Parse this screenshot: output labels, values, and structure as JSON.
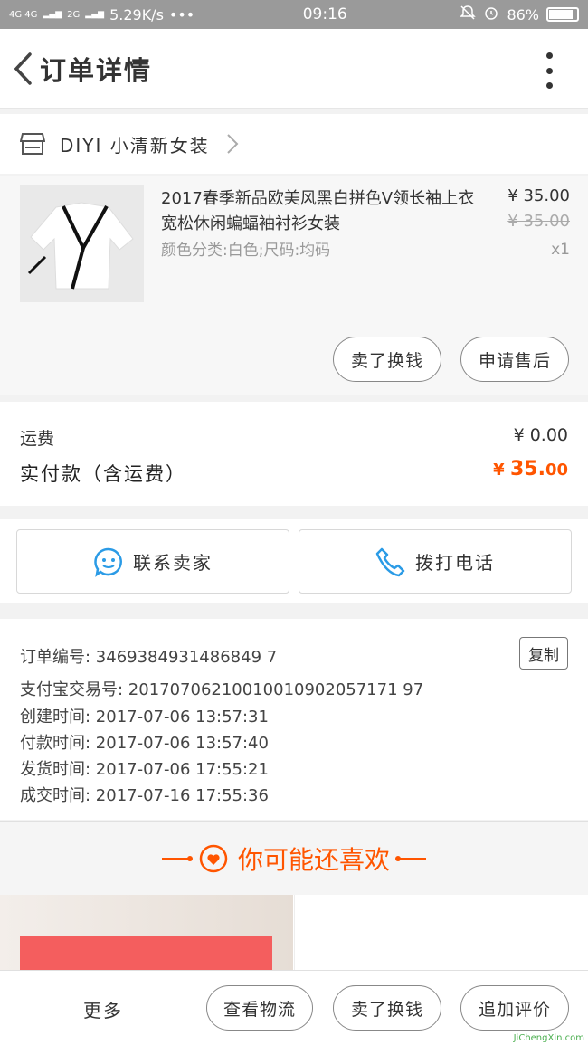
{
  "status_bar": {
    "network": "4G 4G",
    "network2": "2G",
    "speed": "5.29K/s",
    "dots": "•••",
    "time": "09:16",
    "battery": "86%",
    "battery_level": 0.86
  },
  "nav": {
    "title": "订单详情"
  },
  "shop": {
    "name": "DIYI 小清新女装"
  },
  "product": {
    "title": "2017春季新品欧美风黑白拼色V领长袖上衣宽松休闲蝙蝠袖衬衫女装",
    "attributes": "颜色分类:白色;尺码:均码",
    "price": "¥ 35.00",
    "original_price": "¥ 35.00",
    "quantity": "x1",
    "buttons": {
      "sell_swap": "卖了换钱",
      "after_sale": "申请售后"
    }
  },
  "fees": {
    "shipping_label": "运费",
    "shipping_value": "¥ 0.00",
    "paid_label": "实付款（含运费）",
    "paid_currency": "¥ ",
    "paid_int": "35.",
    "paid_dec": "00"
  },
  "contact": {
    "seller": "联系卖家",
    "call": "拨打电话"
  },
  "order_info": {
    "order_no": "订单编号: 3469384931486849 7",
    "copy": "复制",
    "alipay_no": "支付宝交易号: 20170706210010010902057171 97",
    "created": "创建时间: 2017-07-06 13:57:31",
    "paid": "付款时间: 2017-07-06 13:57:40",
    "shipped": "发货时间: 2017-07-06 17:55:21",
    "completed": "成交时间: 2017-07-16 17:55:36"
  },
  "recommend": {
    "heading": "你可能还喜欢"
  },
  "bottom_bar": {
    "more": "更多",
    "logistics": "查看物流",
    "sell_swap": "卖了换钱",
    "review": "追加评价"
  },
  "watermark": "JiChengXin.com",
  "colors": {
    "accent": "#ff5500",
    "statusbar": "#9a9a9a",
    "icon_blue": "#2b9be6"
  }
}
